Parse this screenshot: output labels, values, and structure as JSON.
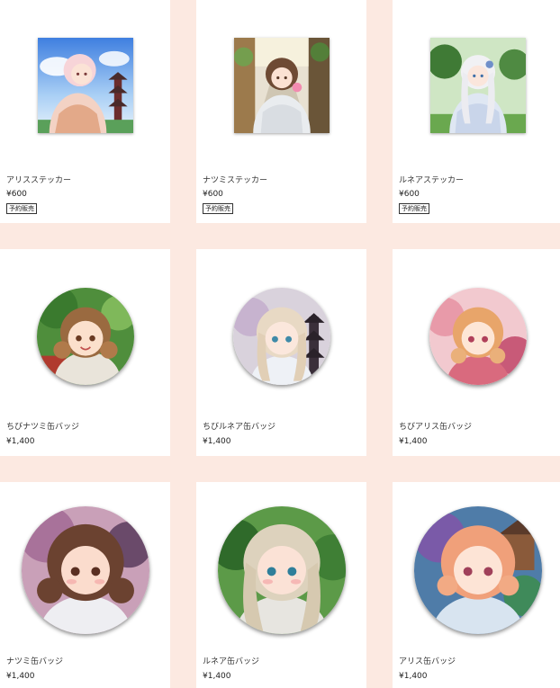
{
  "products": [
    {
      "name": "アリスステッカー",
      "price": "¥600",
      "tag": "予約販売",
      "image_icon": "alice-sticker-image"
    },
    {
      "name": "ナツミステッカー",
      "price": "¥600",
      "tag": "予約販売",
      "image_icon": "natsumi-sticker-image"
    },
    {
      "name": "ルネアステッカー",
      "price": "¥600",
      "tag": "予約販売",
      "image_icon": "runea-sticker-image"
    },
    {
      "name": "ちびナツミ缶バッジ",
      "price": "¥1,400",
      "image_icon": "chibi-natsumi-badge-image"
    },
    {
      "name": "ちびルネア缶バッジ",
      "price": "¥1,400",
      "image_icon": "chibi-runea-badge-image"
    },
    {
      "name": "ちびアリス缶バッジ",
      "price": "¥1,400",
      "image_icon": "chibi-alice-badge-image"
    },
    {
      "name": "ナツミ缶バッジ",
      "price": "¥1,400",
      "image_icon": "natsumi-badge-image"
    },
    {
      "name": "ルネア缶バッジ",
      "price": "¥1,400",
      "image_icon": "runea-badge-image"
    },
    {
      "name": "アリス缶バッジ",
      "price": "¥1,400",
      "image_icon": "alice-badge-image"
    }
  ],
  "colors": {
    "page_background": "#fce9e1",
    "card_background": "#ffffff"
  }
}
